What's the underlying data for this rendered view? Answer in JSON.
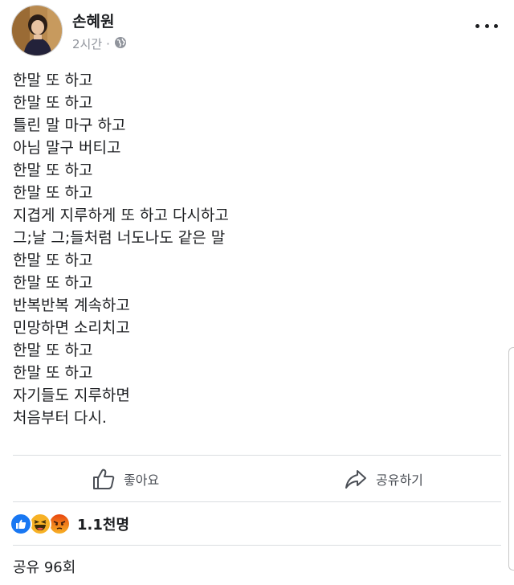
{
  "post": {
    "author": "손혜원",
    "time": "2시간",
    "separator": "·",
    "privacy_icon": "globe-icon",
    "more_icon": "more-options-icon",
    "body_lines": [
      "한말 또 하고",
      "한말 또 하고",
      "틀린 말 마구 하고",
      "아님 말구 버티고",
      "한말 또 하고",
      "한말 또 하고",
      "지겹게 지루하게 또 하고 다시하고",
      "그;날 그;들처럼 너도나도 같은 말",
      "한말 또 하고",
      "한말 또 하고",
      "반복반복 계속하고",
      "민망하면 소리치고",
      "한말 또 하고",
      "한말 또 하고",
      "자기들도 지루하면",
      "처음부터 다시."
    ]
  },
  "actions": {
    "like_label": "좋아요",
    "like_icon": "thumbs-up-icon",
    "share_label": "공유하기",
    "share_icon": "share-arrow-icon"
  },
  "reactions": {
    "icons": [
      "like-reaction-icon",
      "haha-reaction-icon",
      "angry-reaction-icon"
    ],
    "count": "1.1천명"
  },
  "shares": {
    "text": "공유 96회"
  },
  "colors": {
    "like_blue": "#1877f2",
    "haha_yellow": "#f7b125",
    "angry_orange": "#e9710f",
    "meta_gray": "#90949c"
  }
}
